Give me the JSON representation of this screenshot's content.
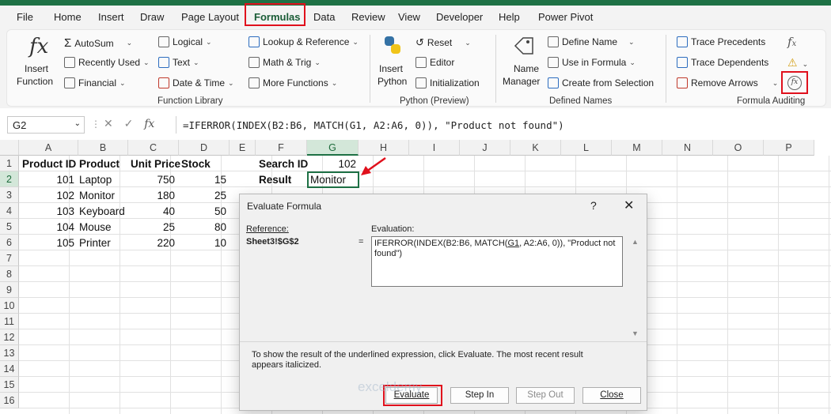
{
  "tabs": [
    "File",
    "Home",
    "Insert",
    "Draw",
    "Page Layout",
    "Formulas",
    "Data",
    "Review",
    "View",
    "Developer",
    "Help",
    "Power Pivot"
  ],
  "active_tab": "Formulas",
  "ribbon": {
    "insert_function": [
      "Insert",
      "Function"
    ],
    "function_library": {
      "items": [
        "AutoSum",
        "Recently Used",
        "Financial",
        "Logical",
        "Text",
        "Date & Time",
        "Lookup & Reference",
        "Math & Trig",
        "More Functions"
      ],
      "label": "Function Library"
    },
    "python": {
      "insert": [
        "Insert",
        "Python"
      ],
      "items": [
        "Reset",
        "Editor",
        "Initialization"
      ],
      "label": "Python (Preview)"
    },
    "defined_names": {
      "name_manager": [
        "Name",
        "Manager"
      ],
      "items": [
        "Define Name",
        "Use in Formula",
        "Create from Selection"
      ],
      "label": "Defined Names"
    },
    "auditing": {
      "items": [
        "Trace Precedents",
        "Trace Dependents",
        "Remove Arrows"
      ],
      "label": "Formula Auditing"
    }
  },
  "formula_bar": {
    "name_box": "G2",
    "fx": "fx",
    "formula": "=IFERROR(INDEX(B2:B6, MATCH(G1, A2:A6, 0)), \"Product not found\")"
  },
  "columns": [
    "A",
    "B",
    "C",
    "D",
    "E",
    "F",
    "G",
    "H",
    "I",
    "J",
    "K",
    "L",
    "M",
    "N",
    "O",
    "P"
  ],
  "rows": [
    "1",
    "2",
    "3",
    "4",
    "5",
    "6",
    "7",
    "8",
    "9",
    "10",
    "11",
    "12",
    "13",
    "14",
    "15",
    "16"
  ],
  "table": {
    "headers": [
      "Product ID",
      "Product",
      "Unit Price",
      "Stock"
    ],
    "data": [
      [
        "101",
        "Laptop",
        "750",
        "15"
      ],
      [
        "102",
        "Monitor",
        "180",
        "25"
      ],
      [
        "103",
        "Keyboard",
        "40",
        "50"
      ],
      [
        "104",
        "Mouse",
        "25",
        "80"
      ],
      [
        "105",
        "Printer",
        "220",
        "10"
      ]
    ]
  },
  "lookup": {
    "search_label": "Search ID",
    "search_value": "102",
    "result_label": "Result",
    "result_value": "Monitor"
  },
  "dialog": {
    "title": "Evaluate Formula",
    "help": "?",
    "close": "✕",
    "reference_label": "Reference:",
    "reference_value": "Sheet3!$G$2",
    "equals": "=",
    "evaluation_label": "Evaluation:",
    "evaluation_pre": "IFERROR(INDEX(B2:B6, MATCH(",
    "evaluation_underlined": "G1",
    "evaluation_post": ", A2:A6, 0)), \"Product not found\")",
    "message": "To show the result of the underlined expression, click Evaluate.  The most recent result appears italicized.",
    "buttons": [
      "Evaluate",
      "Step In",
      "Step Out",
      "Close"
    ]
  },
  "colors": {
    "accent": "#1e7145",
    "highlight": "#e0101c"
  },
  "watermark": "exceldemy"
}
